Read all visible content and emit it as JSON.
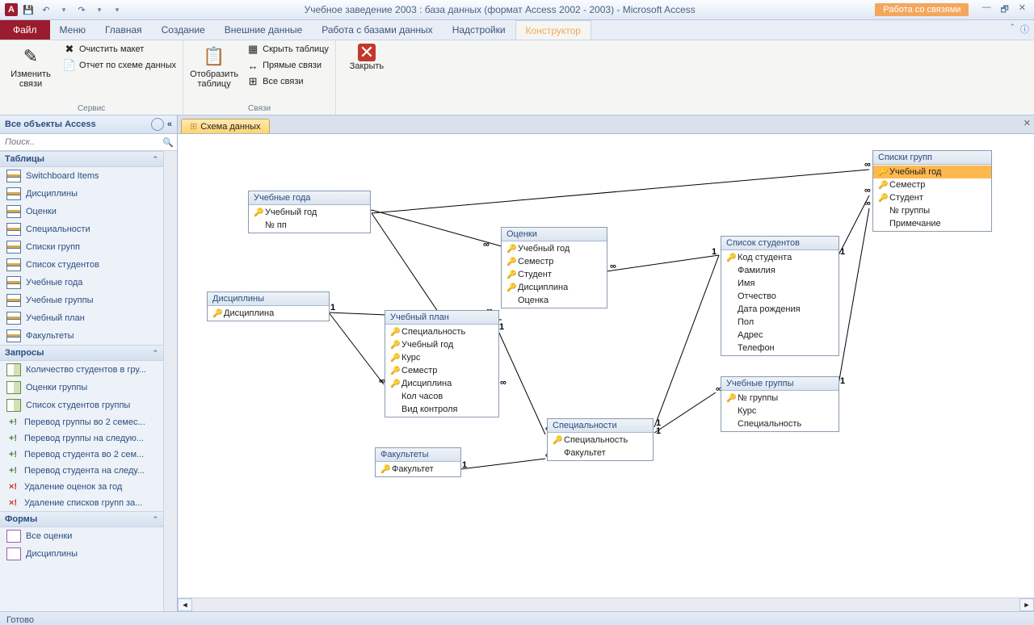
{
  "title": "Учебное заведение 2003 : база данных (формат Access 2002 - 2003)  -  Microsoft Access",
  "context_tool": "Работа со связями",
  "menu": {
    "file": "Файл",
    "items": [
      "Меню",
      "Главная",
      "Создание",
      "Внешние данные",
      "Работа с базами данных",
      "Надстройки",
      "Конструктор"
    ]
  },
  "ribbon": {
    "g1_title": "Сервис",
    "g1_big": "Изменить связи",
    "g1_s1": "Очистить макет",
    "g1_s2": "Отчет по схеме данных",
    "g2_title": "Связи",
    "g2_big": "Отобразить таблицу",
    "g2_s1": "Скрыть таблицу",
    "g2_s2": "Прямые связи",
    "g2_s3": "Все связи",
    "g3_big": "Закрыть"
  },
  "nav": {
    "head": "Все объекты Access",
    "search_ph": "Поиск..",
    "cat1": "Таблицы",
    "tables": [
      "Switchboard Items",
      "Дисциплины",
      "Оценки",
      "Специальности",
      "Списки групп",
      "Список студентов",
      "Учебные года",
      "Учебные группы",
      "Учебный план",
      "Факультеты"
    ],
    "cat2": "Запросы",
    "queries": [
      {
        "t": "sel",
        "l": "Количество студентов в гру..."
      },
      {
        "t": "sel",
        "l": "Оценки группы"
      },
      {
        "t": "sel",
        "l": "Список студентов группы"
      },
      {
        "t": "upd",
        "l": "Перевод группы во 2 семес..."
      },
      {
        "t": "upd",
        "l": "Перевод группы на следую..."
      },
      {
        "t": "upd",
        "l": "Перевод студента во 2 сем..."
      },
      {
        "t": "upd",
        "l": "Перевод студента на следу..."
      },
      {
        "t": "del",
        "l": "Удаление оценок за год"
      },
      {
        "t": "del",
        "l": "Удаление списков групп за..."
      }
    ],
    "cat3": "Формы",
    "forms": [
      "Все оценки",
      "Дисциплины"
    ]
  },
  "doc_tab": "Схема данных",
  "tables": {
    "t1": {
      "title": "Учебные года",
      "fields": [
        {
          "k": true,
          "n": "Учебный год"
        },
        {
          "k": false,
          "n": "№ пп"
        }
      ]
    },
    "t2": {
      "title": "Дисциплины",
      "fields": [
        {
          "k": true,
          "n": "Дисциплина"
        }
      ]
    },
    "t3": {
      "title": "Учебный план",
      "fields": [
        {
          "k": true,
          "n": "Специальность"
        },
        {
          "k": true,
          "n": "Учебный год"
        },
        {
          "k": true,
          "n": "Курс"
        },
        {
          "k": true,
          "n": "Семестр"
        },
        {
          "k": true,
          "n": "Дисциплина"
        },
        {
          "k": false,
          "n": "Кол часов"
        },
        {
          "k": false,
          "n": "Вид контроля"
        }
      ]
    },
    "t4": {
      "title": "Оценки",
      "fields": [
        {
          "k": true,
          "n": "Учебный год"
        },
        {
          "k": true,
          "n": "Семестр"
        },
        {
          "k": true,
          "n": "Студент"
        },
        {
          "k": true,
          "n": "Дисциплина"
        },
        {
          "k": false,
          "n": "Оценка"
        }
      ]
    },
    "t5": {
      "title": "Факультеты",
      "fields": [
        {
          "k": true,
          "n": "Факультет"
        }
      ]
    },
    "t6": {
      "title": "Специальности",
      "fields": [
        {
          "k": true,
          "n": "Специальность"
        },
        {
          "k": false,
          "n": "Факультет"
        }
      ]
    },
    "t7": {
      "title": "Список студентов",
      "fields": [
        {
          "k": true,
          "n": "Код студента"
        },
        {
          "k": false,
          "n": "Фамилия"
        },
        {
          "k": false,
          "n": "Имя"
        },
        {
          "k": false,
          "n": "Отчество"
        },
        {
          "k": false,
          "n": "Дата рождения"
        },
        {
          "k": false,
          "n": "Пол"
        },
        {
          "k": false,
          "n": "Адрес"
        },
        {
          "k": false,
          "n": "Телефон"
        }
      ]
    },
    "t8": {
      "title": "Учебные группы",
      "fields": [
        {
          "k": true,
          "n": "№ группы"
        },
        {
          "k": false,
          "n": "Курс"
        },
        {
          "k": false,
          "n": "Специальность"
        }
      ]
    },
    "t9": {
      "title": "Списки групп",
      "fields": [
        {
          "k": true,
          "n": "Учебный год",
          "sel": true
        },
        {
          "k": true,
          "n": "Семестр"
        },
        {
          "k": true,
          "n": "Студент"
        },
        {
          "k": false,
          "n": "№ группы"
        },
        {
          "k": false,
          "n": "Примечание"
        }
      ]
    }
  },
  "status": "Готово"
}
